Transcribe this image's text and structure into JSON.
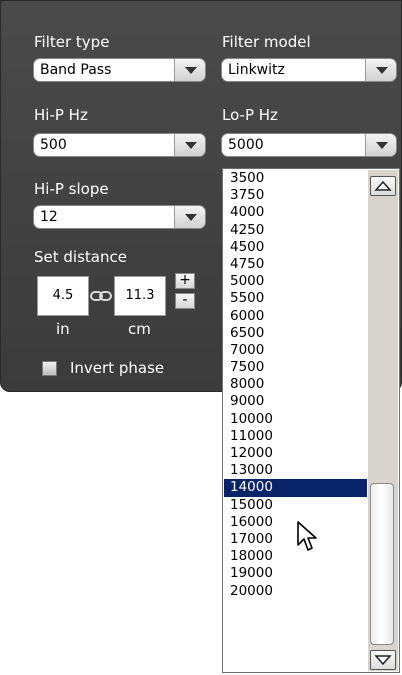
{
  "filter_type": {
    "label": "Filter type",
    "value": "Band Pass"
  },
  "filter_model": {
    "label": "Filter model",
    "value": "Linkwitz"
  },
  "hip": {
    "label": "Hi-P Hz",
    "value": "500"
  },
  "lop": {
    "label": "Lo-P Hz",
    "value": "5000"
  },
  "hip_slope": {
    "label": "Hi-P slope",
    "value": "12"
  },
  "distance": {
    "label": "Set distance",
    "inches": "4.5",
    "cm": "11.3",
    "in_unit": "in",
    "cm_unit": "cm",
    "plus": "+",
    "minus": "-"
  },
  "invert_phase": {
    "label": "Invert phase",
    "checked": false
  },
  "lop_options": [
    "3500",
    "3750",
    "4000",
    "4250",
    "4500",
    "4750",
    "5000",
    "5500",
    "6000",
    "6500",
    "7000",
    "7500",
    "8000",
    "9000",
    "10000",
    "11000",
    "12000",
    "13000",
    "14000",
    "15000",
    "16000",
    "17000",
    "18000",
    "19000",
    "20000"
  ],
  "highlighted_option": "14000"
}
